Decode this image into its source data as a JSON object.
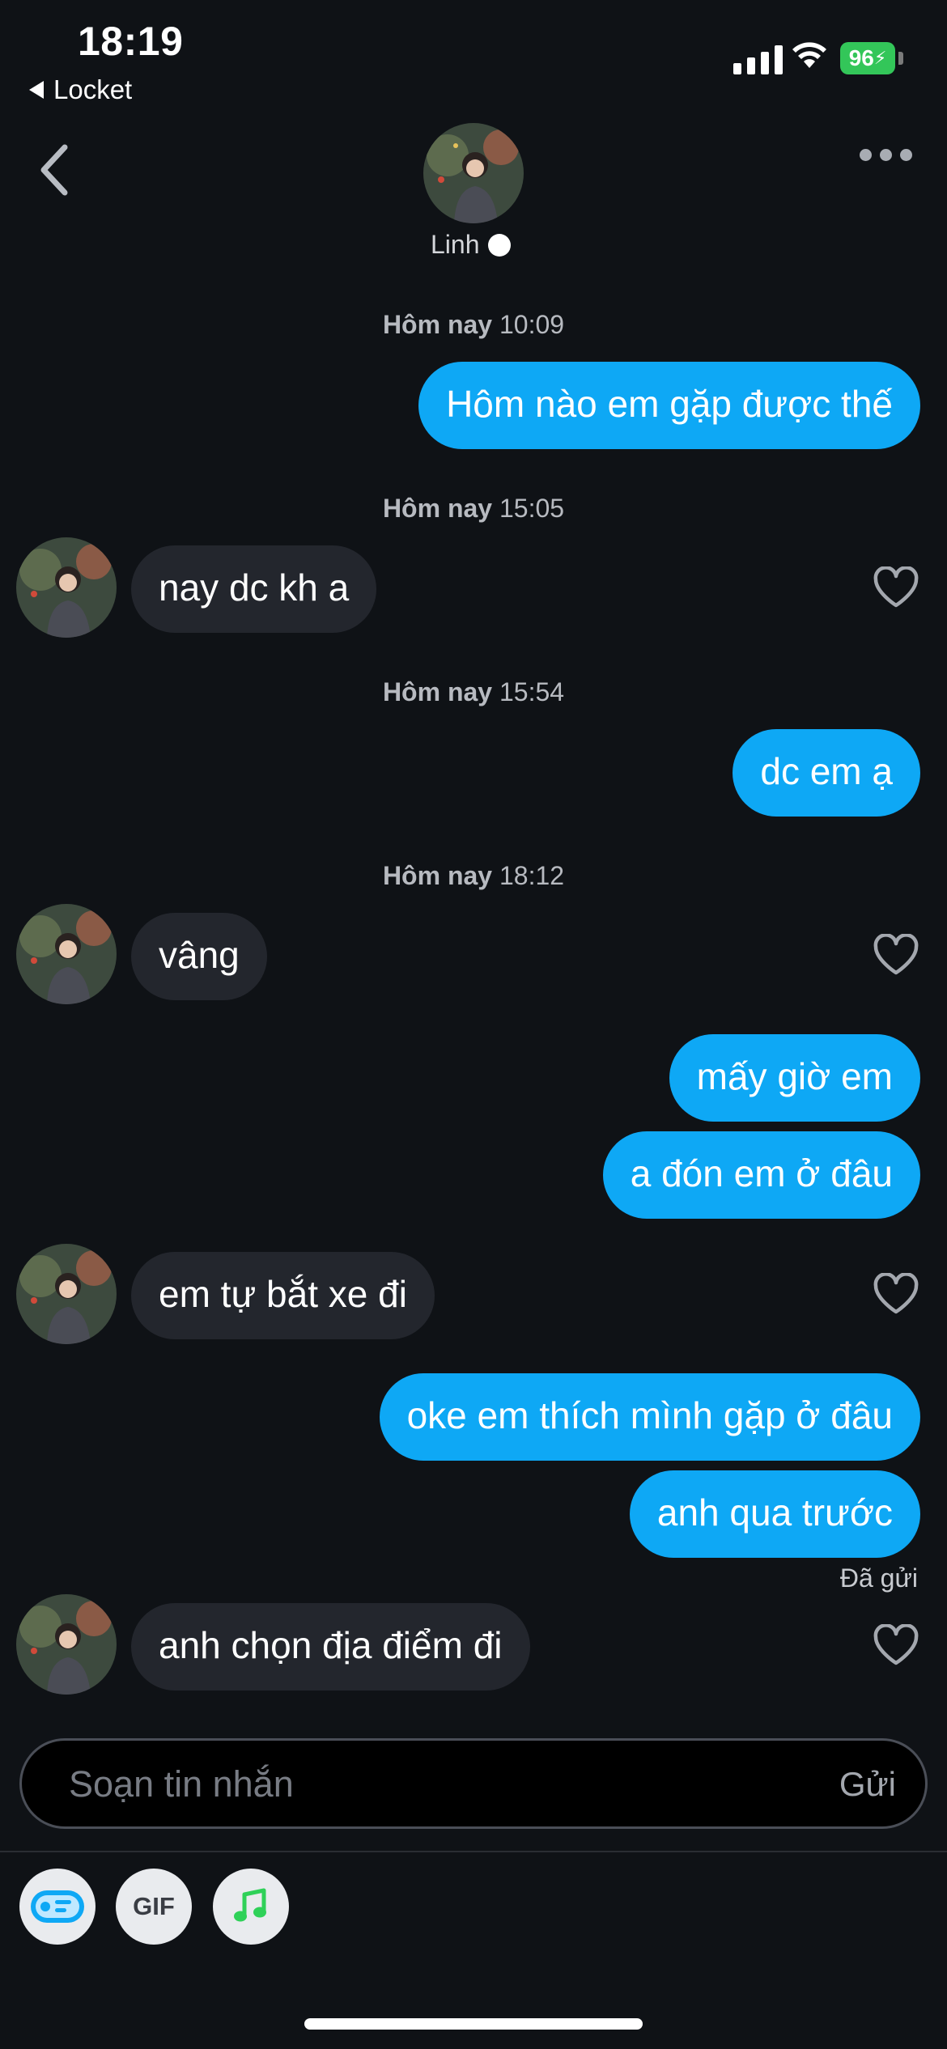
{
  "status_bar": {
    "time": "18:19",
    "back_app": "Locket",
    "battery": "96"
  },
  "header": {
    "name": "Linh"
  },
  "timestamps": [
    {
      "day": "Hôm nay",
      "time": "10:09"
    },
    {
      "day": "Hôm nay",
      "time": "15:05"
    },
    {
      "day": "Hôm nay",
      "time": "15:54"
    },
    {
      "day": "Hôm nay",
      "time": "18:12"
    }
  ],
  "messages": [
    {
      "side": "sent",
      "text": "Hôm nào em gặp được thế"
    },
    {
      "side": "received",
      "text": "nay dc kh a"
    },
    {
      "side": "sent",
      "text": "dc em ạ"
    },
    {
      "side": "received",
      "text": "vâng"
    },
    {
      "side": "sent",
      "text": "mấy giờ em"
    },
    {
      "side": "sent",
      "text": "a đón em ở đâu"
    },
    {
      "side": "received",
      "text": "em tự bắt xe đi"
    },
    {
      "side": "sent",
      "text": "oke em thích mình gặp ở đâu"
    },
    {
      "side": "sent",
      "text": "anh qua trước"
    },
    {
      "side": "received",
      "text": "anh chọn địa điểm đi"
    }
  ],
  "sent_status": "Đã gửi",
  "composer": {
    "placeholder": "Soạn tin nhắn",
    "send_label": "Gửi"
  },
  "tools": {
    "gif_label": "GIF"
  },
  "colors": {
    "sent_bubble": "#0ea8f5",
    "received_bubble": "#23262d",
    "background": "#0f1216",
    "music": "#2fd158",
    "battery": "#33c659"
  }
}
